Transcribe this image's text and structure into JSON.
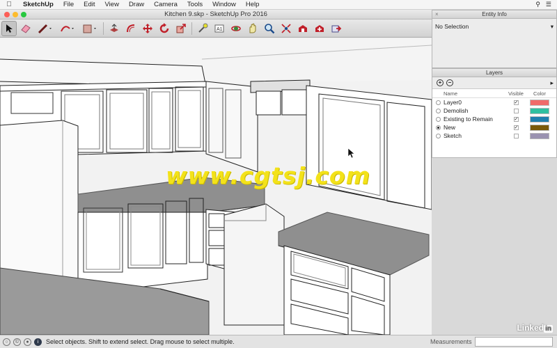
{
  "menubar": {
    "app": "SketchUp",
    "items": [
      "File",
      "Edit",
      "View",
      "Draw",
      "Camera",
      "Tools",
      "Window",
      "Help"
    ]
  },
  "window": {
    "title": "Kitchen 9.skp - SketchUp Pro 2016"
  },
  "toolbar": {
    "tools": [
      "select-tool",
      "eraser-tool",
      "line-tool",
      "arc-tool",
      "shape-tool",
      "push-pull-tool",
      "offset-tool",
      "move-tool",
      "rotate-tool",
      "scale-tool",
      "tape-measure-tool",
      "text-tool",
      "orbit-tool",
      "pan-tool",
      "zoom-tool",
      "zoom-extents-tool",
      "warehouse-tool",
      "extension-warehouse-tool",
      "send-to-layout-tool"
    ]
  },
  "viewport": {
    "watermark": "www.cgtsj.com"
  },
  "entity_info": {
    "title": "Entity Info",
    "selection": "No Selection"
  },
  "layers": {
    "title": "Layers",
    "columns": {
      "name": "Name",
      "visible": "Visible",
      "color": "Color"
    },
    "rows": [
      {
        "name": "Layer0",
        "active": false,
        "visible": true,
        "color": "#f06a6a"
      },
      {
        "name": "Demolish",
        "active": false,
        "visible": false,
        "color": "#2fc0a0"
      },
      {
        "name": "Existing to Remain",
        "active": false,
        "visible": true,
        "color": "#1f7fae"
      },
      {
        "name": "New",
        "active": true,
        "visible": true,
        "color": "#7a5a0a"
      },
      {
        "name": "Sketch",
        "active": false,
        "visible": false,
        "color": "#9a92b0"
      }
    ]
  },
  "status": {
    "message": "Select objects. Shift to extend select. Drag mouse to select multiple.",
    "measurements_label": "Measurements",
    "measurements_value": "",
    "brand": "Linked",
    "brand_in": "in"
  }
}
